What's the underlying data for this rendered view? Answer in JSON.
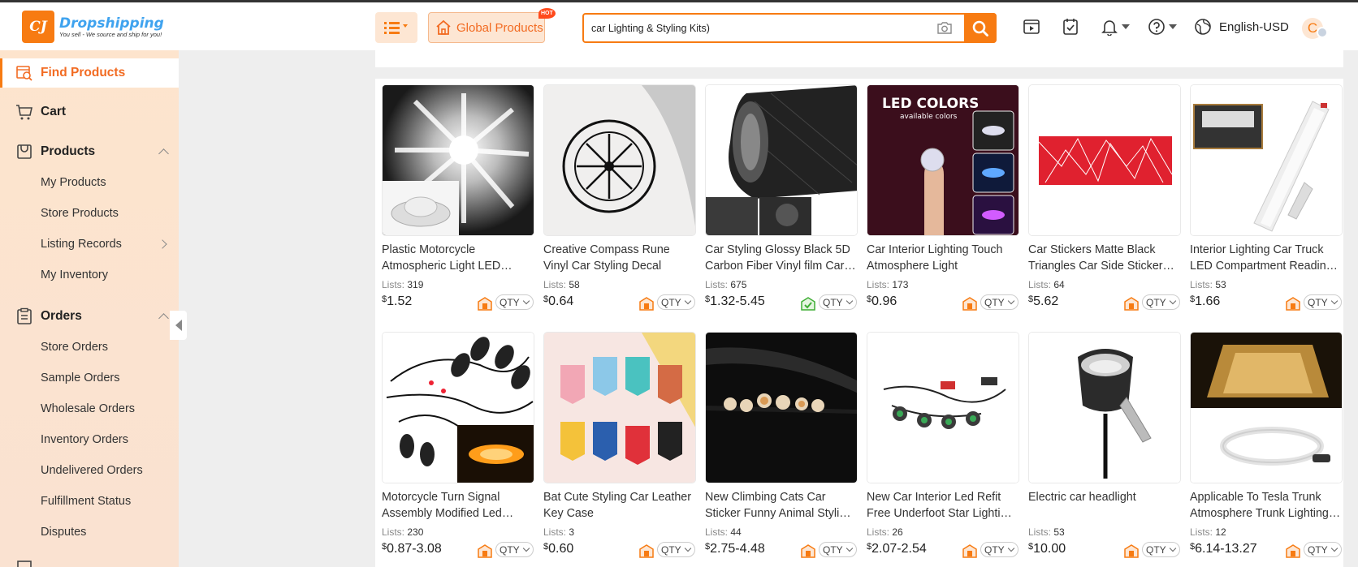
{
  "brand": {
    "name": "Dropshipping",
    "tagline": "You sell - We source and ship for you!",
    "mark": "CJ"
  },
  "header": {
    "global_products_label": "Global Products",
    "hot_badge": "HOT",
    "search": {
      "value": "car Lighting & Styling Kits)"
    },
    "language_currency": "English-USD",
    "avatar_initial": "C"
  },
  "sidebar": {
    "find_products": "Find Products",
    "cart": "Cart",
    "products": {
      "label": "Products",
      "items": [
        "My Products",
        "Store Products",
        "Listing Records",
        "My Inventory"
      ]
    },
    "orders": {
      "label": "Orders",
      "items": [
        "Store Orders",
        "Sample Orders",
        "Wholesale Orders",
        "Inventory Orders",
        "Undelivered Orders",
        "Fulfillment Status",
        "Disputes"
      ]
    }
  },
  "products_grid": {
    "lists_label": "Lists:",
    "qty_label": "QTY",
    "currency_symbol": "$",
    "items": [
      {
        "title": "Plastic Motorcycle Atmospheric Light LED Decorative Lights",
        "lists": "319",
        "price": "1.52",
        "stock_icon": "warehouse-icon"
      },
      {
        "title": "Creative Compass Rune Vinyl Car Styling Decal",
        "lists": "58",
        "price": "0.64",
        "stock_icon": "warehouse-icon"
      },
      {
        "title": "Car Styling Glossy Black 5D Carbon Fiber Vinyl film Car Wrap",
        "lists": "675",
        "price": "1.32-5.45",
        "stock_icon": "verified-warehouse-icon"
      },
      {
        "title": "Car Interior Lighting Touch Atmosphere Light",
        "lists": "173",
        "price": "0.96",
        "stock_icon": "warehouse-icon"
      },
      {
        "title": "Car Stickers Matte Black Triangles Car Side Sticker Decal",
        "lists": "64",
        "price": "5.62",
        "stock_icon": "warehouse-icon"
      },
      {
        "title": "Interior Lighting Car Truck LED Compartment Reading Light",
        "lists": "53",
        "price": "1.66",
        "stock_icon": "warehouse-icon"
      },
      {
        "title": "Motorcycle Turn Signal Assembly Modified Led Lights",
        "lists": "230",
        "price": "0.87-3.08",
        "stock_icon": "warehouse-icon"
      },
      {
        "title": "Bat Cute Styling Car Leather Key Case",
        "lists": "3",
        "price": "0.60",
        "stock_icon": "warehouse-icon"
      },
      {
        "title": "New Climbing Cats Car Sticker Funny Animal Styling Decal",
        "lists": "44",
        "price": "2.75-4.48",
        "stock_icon": "warehouse-icon"
      },
      {
        "title": "New Car Interior Led Refit Free Underfoot Star Lighting Kit",
        "lists": "26",
        "price": "2.07-2.54",
        "stock_icon": "warehouse-icon"
      },
      {
        "title": "Electric car headlight",
        "lists": "53",
        "price": "10.00",
        "stock_icon": "warehouse-icon"
      },
      {
        "title": "Applicable To Tesla Trunk Atmosphere Trunk Lighting Strip",
        "lists": "12",
        "price": "6.14-13.27",
        "stock_icon": "warehouse-icon"
      }
    ]
  },
  "colors": {
    "accent": "#f77b12",
    "sidebar_bg": "#fde4cd",
    "logo_blue": "#3fa3ef"
  }
}
